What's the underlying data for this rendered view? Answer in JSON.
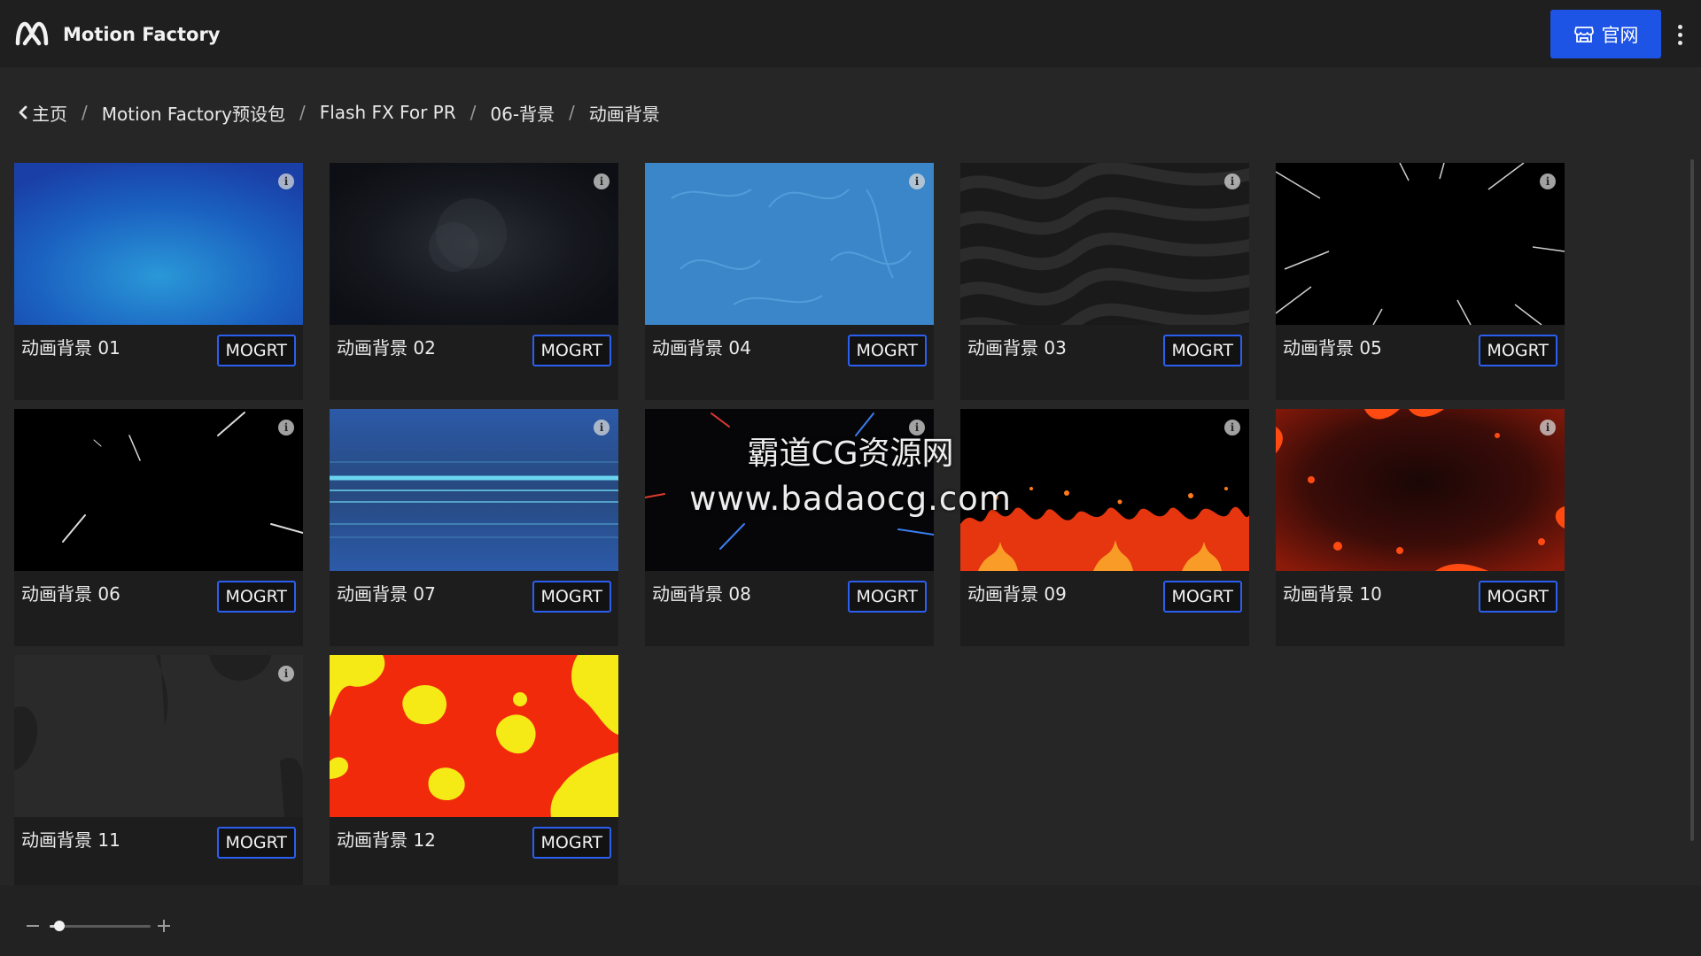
{
  "header": {
    "logo_icon": "motion-factory-logo",
    "title": "Motion Factory",
    "site_button": {
      "icon": "storefront-icon",
      "label": "官网"
    },
    "more_icon": "more-vertical-icon"
  },
  "breadcrumb": {
    "back_icon": "chevron-left-icon",
    "items": [
      "主页",
      "Motion Factory预设包",
      "Flash FX For PR",
      "06-背景",
      "动画背景"
    ],
    "separator": "/"
  },
  "grid": {
    "badge_label": "MOGRT",
    "info_icon": "info-icon",
    "items": [
      {
        "name": "动画背景 01",
        "thumb": "blue-gradient",
        "has_info": true
      },
      {
        "name": "动画背景 02",
        "thumb": "dark-smoke",
        "has_info": true
      },
      {
        "name": "动画背景 04",
        "thumb": "blue-waves",
        "has_info": true
      },
      {
        "name": "动画背景 03",
        "thumb": "zebra-stripes",
        "has_info": true
      },
      {
        "name": "动画背景 05",
        "thumb": "speed-lines",
        "has_info": true
      },
      {
        "name": "动画背景 06",
        "thumb": "meteor-streaks",
        "has_info": true
      },
      {
        "name": "动画背景 07",
        "thumb": "blue-light-lines",
        "has_info": true
      },
      {
        "name": "动画背景 08",
        "thumb": "color-streaks",
        "has_info": true
      },
      {
        "name": "动画背景 09",
        "thumb": "fire-flames",
        "has_info": true
      },
      {
        "name": "动画背景 10",
        "thumb": "fire-embers",
        "has_info": true
      },
      {
        "name": "动画背景 11",
        "thumb": "dark-blobs",
        "has_info": true
      },
      {
        "name": "动画背景 12",
        "thumb": "red-yellow-blobs",
        "has_info": false
      }
    ]
  },
  "watermark": {
    "line1": "霸道CG资源网",
    "line2": "www.badaocg.com"
  },
  "zoom": {
    "value": 0.1,
    "minus_icon": "zoom-out-icon",
    "plus_icon": "zoom-in-icon"
  },
  "colors": {
    "accent": "#1e54e6",
    "badge_border": "#2b5ff0",
    "background": "#262626",
    "header": "#1f1f1f",
    "card": "#1d1d1d"
  }
}
